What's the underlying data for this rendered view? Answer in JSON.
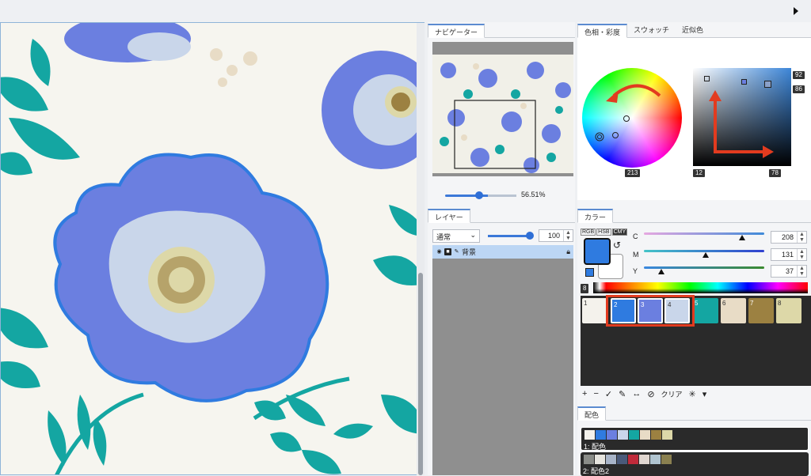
{
  "navigator": {
    "tab": "ナビゲーター",
    "zoom": "56.51%"
  },
  "layer": {
    "tab": "レイヤー",
    "blend_mode": "通常",
    "opacity": "100",
    "layer_name": "背景"
  },
  "hue": {
    "tabs": [
      "色相・彩度",
      "スウォッチ",
      "近似色"
    ],
    "hue_value": "213",
    "s_low": "12",
    "s_high": "78",
    "v_top": "92",
    "v_mid": "86"
  },
  "color": {
    "tab": "カラー",
    "modes": [
      "RGB",
      "HSB",
      "CMY"
    ],
    "channel_c": "C",
    "channel_m": "M",
    "channel_y": "Y",
    "c_value": "208",
    "m_value": "131",
    "y_value": "37",
    "palette_count": "8",
    "clear_label": "クリア"
  },
  "swatches": [
    {
      "num": "1",
      "color": "#f4f2ec"
    },
    {
      "num": "2",
      "color": "#2f7be0"
    },
    {
      "num": "3",
      "color": "#6b7fe0"
    },
    {
      "num": "4",
      "color": "#c9d6ea"
    },
    {
      "num": "5",
      "color": "#14a6a2"
    },
    {
      "num": "6",
      "color": "#e8dcc6"
    },
    {
      "num": "7",
      "color": "#9c8141"
    },
    {
      "num": "8",
      "color": "#ddd8a8"
    }
  ],
  "haishoku": {
    "tab": "配色",
    "set1_name": "1: 配色",
    "set2_name": "2: 配色2"
  },
  "colors": {
    "accent": "#2f6fd6",
    "highlight": "#e23b1f",
    "main_color": "#2f7be0"
  }
}
